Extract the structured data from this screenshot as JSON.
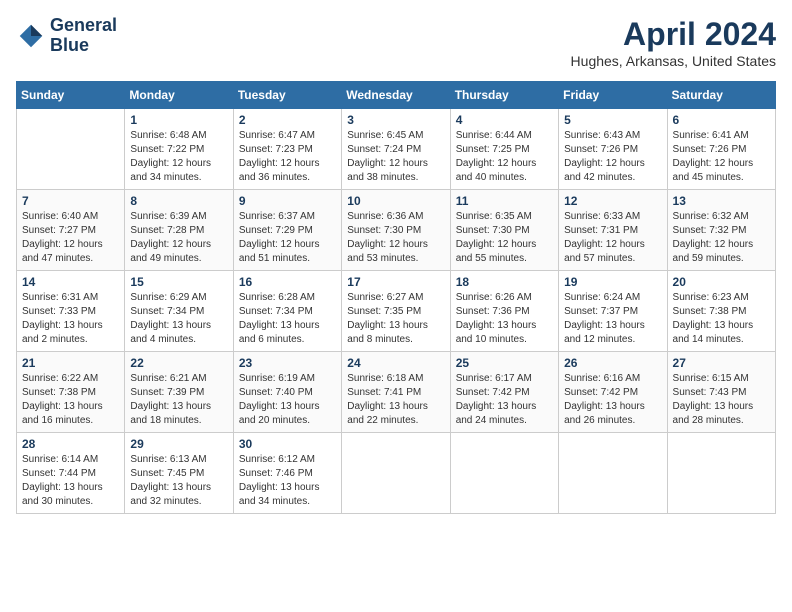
{
  "header": {
    "logo_line1": "General",
    "logo_line2": "Blue",
    "month": "April 2024",
    "location": "Hughes, Arkansas, United States"
  },
  "days_of_week": [
    "Sunday",
    "Monday",
    "Tuesday",
    "Wednesday",
    "Thursday",
    "Friday",
    "Saturday"
  ],
  "weeks": [
    [
      {
        "day": "",
        "empty": true
      },
      {
        "day": "1",
        "sunrise": "6:48 AM",
        "sunset": "7:22 PM",
        "daylight": "12 hours and 34 minutes."
      },
      {
        "day": "2",
        "sunrise": "6:47 AM",
        "sunset": "7:23 PM",
        "daylight": "12 hours and 36 minutes."
      },
      {
        "day": "3",
        "sunrise": "6:45 AM",
        "sunset": "7:24 PM",
        "daylight": "12 hours and 38 minutes."
      },
      {
        "day": "4",
        "sunrise": "6:44 AM",
        "sunset": "7:25 PM",
        "daylight": "12 hours and 40 minutes."
      },
      {
        "day": "5",
        "sunrise": "6:43 AM",
        "sunset": "7:26 PM",
        "daylight": "12 hours and 42 minutes."
      },
      {
        "day": "6",
        "sunrise": "6:41 AM",
        "sunset": "7:26 PM",
        "daylight": "12 hours and 45 minutes."
      }
    ],
    [
      {
        "day": "7",
        "sunrise": "6:40 AM",
        "sunset": "7:27 PM",
        "daylight": "12 hours and 47 minutes."
      },
      {
        "day": "8",
        "sunrise": "6:39 AM",
        "sunset": "7:28 PM",
        "daylight": "12 hours and 49 minutes."
      },
      {
        "day": "9",
        "sunrise": "6:37 AM",
        "sunset": "7:29 PM",
        "daylight": "12 hours and 51 minutes."
      },
      {
        "day": "10",
        "sunrise": "6:36 AM",
        "sunset": "7:30 PM",
        "daylight": "12 hours and 53 minutes."
      },
      {
        "day": "11",
        "sunrise": "6:35 AM",
        "sunset": "7:30 PM",
        "daylight": "12 hours and 55 minutes."
      },
      {
        "day": "12",
        "sunrise": "6:33 AM",
        "sunset": "7:31 PM",
        "daylight": "12 hours and 57 minutes."
      },
      {
        "day": "13",
        "sunrise": "6:32 AM",
        "sunset": "7:32 PM",
        "daylight": "12 hours and 59 minutes."
      }
    ],
    [
      {
        "day": "14",
        "sunrise": "6:31 AM",
        "sunset": "7:33 PM",
        "daylight": "13 hours and 2 minutes."
      },
      {
        "day": "15",
        "sunrise": "6:29 AM",
        "sunset": "7:34 PM",
        "daylight": "13 hours and 4 minutes."
      },
      {
        "day": "16",
        "sunrise": "6:28 AM",
        "sunset": "7:34 PM",
        "daylight": "13 hours and 6 minutes."
      },
      {
        "day": "17",
        "sunrise": "6:27 AM",
        "sunset": "7:35 PM",
        "daylight": "13 hours and 8 minutes."
      },
      {
        "day": "18",
        "sunrise": "6:26 AM",
        "sunset": "7:36 PM",
        "daylight": "13 hours and 10 minutes."
      },
      {
        "day": "19",
        "sunrise": "6:24 AM",
        "sunset": "7:37 PM",
        "daylight": "13 hours and 12 minutes."
      },
      {
        "day": "20",
        "sunrise": "6:23 AM",
        "sunset": "7:38 PM",
        "daylight": "13 hours and 14 minutes."
      }
    ],
    [
      {
        "day": "21",
        "sunrise": "6:22 AM",
        "sunset": "7:38 PM",
        "daylight": "13 hours and 16 minutes."
      },
      {
        "day": "22",
        "sunrise": "6:21 AM",
        "sunset": "7:39 PM",
        "daylight": "13 hours and 18 minutes."
      },
      {
        "day": "23",
        "sunrise": "6:19 AM",
        "sunset": "7:40 PM",
        "daylight": "13 hours and 20 minutes."
      },
      {
        "day": "24",
        "sunrise": "6:18 AM",
        "sunset": "7:41 PM",
        "daylight": "13 hours and 22 minutes."
      },
      {
        "day": "25",
        "sunrise": "6:17 AM",
        "sunset": "7:42 PM",
        "daylight": "13 hours and 24 minutes."
      },
      {
        "day": "26",
        "sunrise": "6:16 AM",
        "sunset": "7:42 PM",
        "daylight": "13 hours and 26 minutes."
      },
      {
        "day": "27",
        "sunrise": "6:15 AM",
        "sunset": "7:43 PM",
        "daylight": "13 hours and 28 minutes."
      }
    ],
    [
      {
        "day": "28",
        "sunrise": "6:14 AM",
        "sunset": "7:44 PM",
        "daylight": "13 hours and 30 minutes."
      },
      {
        "day": "29",
        "sunrise": "6:13 AM",
        "sunset": "7:45 PM",
        "daylight": "13 hours and 32 minutes."
      },
      {
        "day": "30",
        "sunrise": "6:12 AM",
        "sunset": "7:46 PM",
        "daylight": "13 hours and 34 minutes."
      },
      {
        "day": "",
        "empty": true
      },
      {
        "day": "",
        "empty": true
      },
      {
        "day": "",
        "empty": true
      },
      {
        "day": "",
        "empty": true
      }
    ]
  ],
  "labels": {
    "sunrise": "Sunrise:",
    "sunset": "Sunset:",
    "daylight": "Daylight:"
  }
}
